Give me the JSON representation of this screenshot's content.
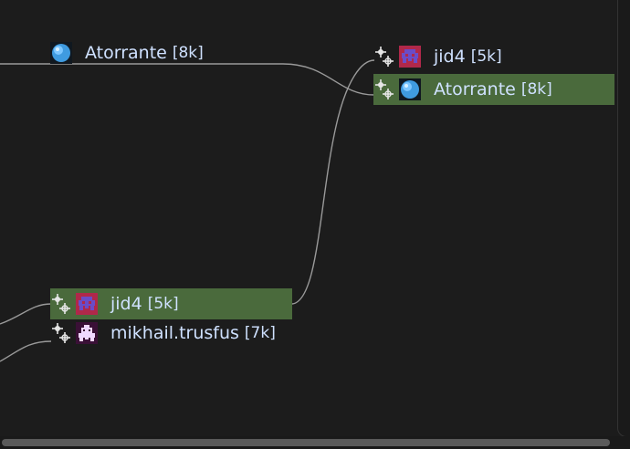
{
  "nodes": {
    "top_left": {
      "name": "Atorrante",
      "size": "[8k]",
      "avatar": "blue-orb-avatar"
    },
    "right_1": {
      "name": "jid4",
      "size": "[5k]",
      "avatar": "pixel-invader-avatar"
    },
    "right_2": {
      "name": "Atorrante",
      "size": "[8k]",
      "avatar": "blue-orb-avatar",
      "highlighted": true
    },
    "bottom_1": {
      "name": "jid4",
      "size": "[5k]",
      "avatar": "pixel-invader-avatar",
      "highlighted": true
    },
    "bottom_2": {
      "name": "mikhail.trusfus",
      "size": "[7k]",
      "avatar": "pixel-ghost-avatar"
    }
  },
  "colors": {
    "background": "#1c1c1c",
    "highlight": "#4a6a3c",
    "text": "#cfe1ff",
    "link": "#9a9a9a"
  }
}
